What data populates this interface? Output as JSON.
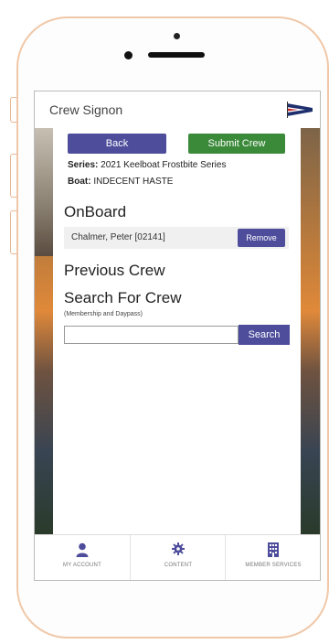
{
  "app": {
    "title": "Crew Signon"
  },
  "actions": {
    "back_label": "Back",
    "submit_label": "Submit Crew"
  },
  "info": {
    "series_label": "Series:",
    "series_value": "2021 Keelboat Frostbite Series",
    "boat_label": "Boat:",
    "boat_value": "INDECENT HASTE"
  },
  "onboard": {
    "heading": "OnBoard",
    "crew": [
      {
        "name": "Chalmer, Peter [02141]",
        "remove_label": "Remove"
      }
    ]
  },
  "previous_crew": {
    "heading": "Previous Crew"
  },
  "search": {
    "heading": "Search For Crew",
    "subtitle": "(Membership and Daypass)",
    "value": "",
    "button_label": "Search"
  },
  "bottom_nav": {
    "items": [
      {
        "label": "MY ACCOUNT",
        "icon": "person-icon"
      },
      {
        "label": "CONTENT",
        "icon": "gear-icon"
      },
      {
        "label": "MEMBER SERVICES",
        "icon": "building-icon"
      }
    ]
  },
  "colors": {
    "primary": "#4e4d9c",
    "success": "#3b8a3a",
    "nav_icon": "#4e4d9c"
  }
}
